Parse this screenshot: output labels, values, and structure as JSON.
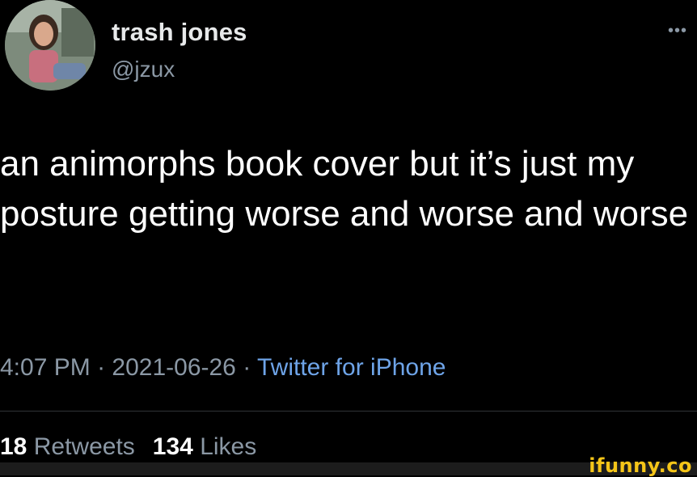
{
  "tweet": {
    "display_name": "trash jones",
    "handle": "@jzux",
    "more_icon": "more-horizontal-icon",
    "text": "an animorphs book cover but it’s just my posture getting worse and worse and worse",
    "time": "4:07 PM",
    "separator": " · ",
    "date": "2021-06-26",
    "source": "Twitter for iPhone",
    "retweets_count": "18",
    "retweets_label": "Retweets",
    "likes_count": "134",
    "likes_label": "Likes"
  },
  "watermark": {
    "text": "ifunny.co",
    "color": "#f5c518"
  },
  "colors": {
    "background": "#000000",
    "secondary_text": "#8b98a5",
    "link": "#6ea4e8"
  }
}
